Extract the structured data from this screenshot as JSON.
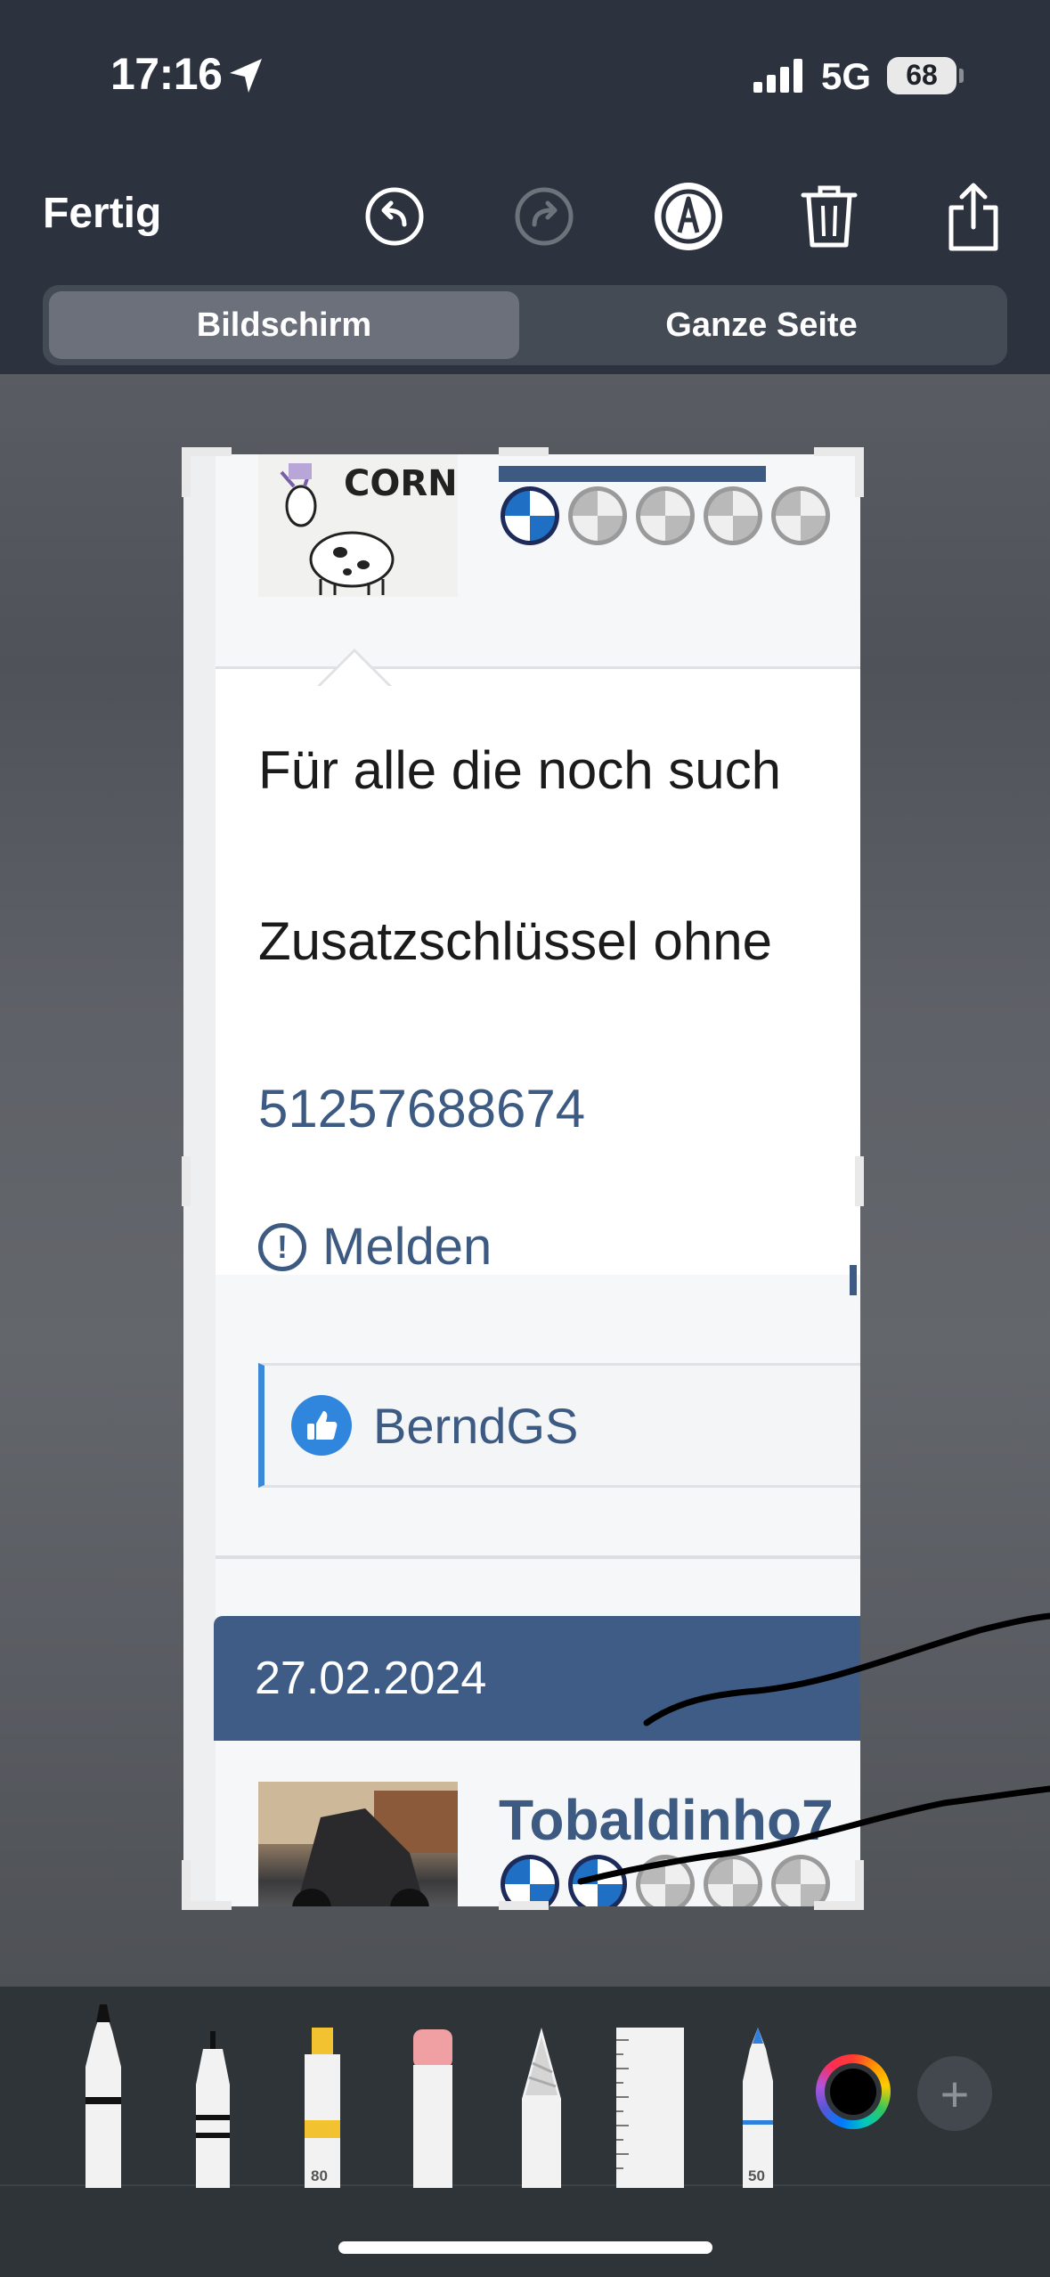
{
  "status_bar": {
    "time": "17:16",
    "network": "5G",
    "battery": "68",
    "icons": [
      "location-arrow-icon",
      "cellular-signal-icon",
      "battery-icon"
    ]
  },
  "toolbar": {
    "done_label": "Fertig",
    "buttons": [
      "undo-icon",
      "redo-icon",
      "markup-pen-icon",
      "trash-icon",
      "share-icon"
    ]
  },
  "segments": {
    "screen": "Bildschirm",
    "full_page": "Ganze Seite",
    "selected": "Bildschirm"
  },
  "screenshot": {
    "avatar_text": "CORN",
    "post_line_1": "Für alle die noch such",
    "post_line_2": "Zusatzschlüssel ohne",
    "part_number": "51257688674",
    "report_label": "Melden",
    "report_icon": "!",
    "liked_by": "BerndGS",
    "date": "27.02.2024",
    "next_user": "Tobaldinho7",
    "rating_top": 1,
    "rating_bottom": 2,
    "rating_max": 5
  },
  "tools": {
    "items": [
      "pen",
      "fineliner",
      "highlighter",
      "eraser",
      "lasso",
      "ruler",
      "pencil"
    ],
    "highlighter_size": "80",
    "pencil_size": "50",
    "selected_color": "#000000"
  },
  "colors": {
    "chrome": "#2d333e",
    "forum_blue": "#3e5c85",
    "like_blue": "#2f86dc"
  }
}
